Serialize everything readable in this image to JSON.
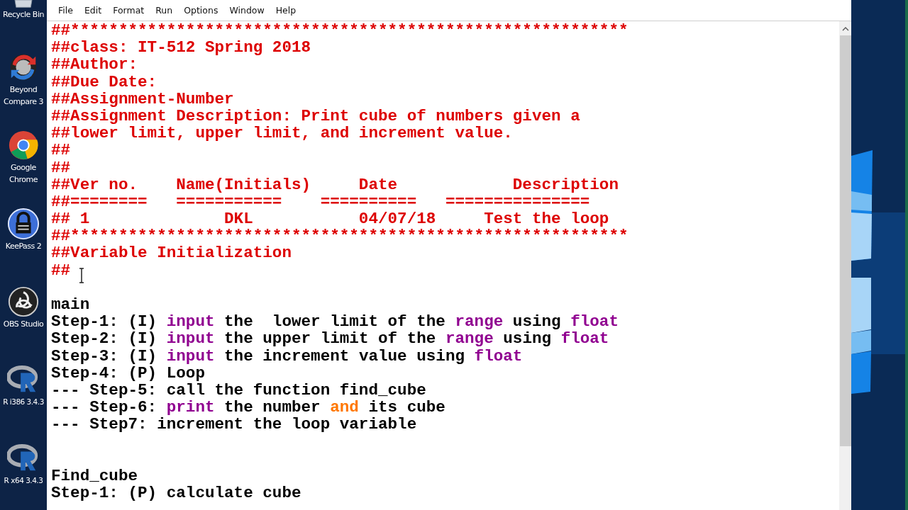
{
  "desktop_icons": [
    {
      "label": "Recycle Bin",
      "kind": "recycle"
    },
    {
      "label": "Beyond Compare 3",
      "kind": "compare"
    },
    {
      "label": "Google Chrome",
      "kind": "browser"
    },
    {
      "label": "KeePass 2",
      "kind": "lock"
    },
    {
      "label": "OBS Studio",
      "kind": "obs"
    },
    {
      "label": "R i386 3.4.3",
      "kind": "r"
    },
    {
      "label": "R x64 3.4.3",
      "kind": "r"
    }
  ],
  "menu": [
    "File",
    "Edit",
    "Format",
    "Run",
    "Options",
    "Window",
    "Help"
  ],
  "code_lines": [
    {
      "kind": "code",
      "segments": [
        {
          "text": "##**********************************************************",
          "kind": "comment"
        }
      ]
    },
    {
      "kind": "code",
      "segments": [
        {
          "text": "##class: IT-512 Spring 2018",
          "kind": "comment"
        }
      ]
    },
    {
      "kind": "code",
      "segments": [
        {
          "text": "##Author:",
          "kind": "comment"
        }
      ]
    },
    {
      "kind": "code",
      "segments": [
        {
          "text": "##Due Date:",
          "kind": "comment"
        }
      ]
    },
    {
      "kind": "code",
      "segments": [
        {
          "text": "##Assignment-Number",
          "kind": "comment"
        }
      ]
    },
    {
      "kind": "code",
      "segments": [
        {
          "text": "##Assignment Description: Print cube of numbers given a",
          "kind": "comment"
        }
      ]
    },
    {
      "kind": "code",
      "segments": [
        {
          "text": "##lower limit, upper limit, and increment value.",
          "kind": "comment"
        }
      ]
    },
    {
      "kind": "code",
      "segments": [
        {
          "text": "##",
          "kind": "comment"
        }
      ]
    },
    {
      "kind": "code",
      "segments": [
        {
          "text": "##",
          "kind": "comment"
        }
      ]
    },
    {
      "kind": "code",
      "segments": [
        {
          "text": "##Ver no.    Name(Initials)     Date            Description",
          "kind": "comment"
        }
      ]
    },
    {
      "kind": "code",
      "segments": [
        {
          "text": "##========   ===========    ==========   ===============",
          "kind": "comment"
        }
      ]
    },
    {
      "kind": "code",
      "segments": [
        {
          "text": "## 1              DKL           04/07/18     Test the loop",
          "kind": "comment"
        }
      ]
    },
    {
      "kind": "code",
      "segments": [
        {
          "text": "##**********************************************************",
          "kind": "comment"
        }
      ]
    },
    {
      "kind": "code",
      "segments": [
        {
          "text": "##Variable Initialization",
          "kind": "comment"
        }
      ]
    },
    {
      "kind": "code",
      "segments": [
        {
          "text": "##",
          "kind": "comment"
        }
      ]
    },
    {
      "kind": "blank"
    },
    {
      "kind": "code",
      "segments": [
        {
          "text": "main",
          "kind": "plain"
        }
      ]
    },
    {
      "kind": "code",
      "segments": [
        {
          "text": "Step-1: (I) ",
          "kind": "plain"
        },
        {
          "text": "input",
          "kind": "builtin"
        },
        {
          "text": " the  lower limit of the ",
          "kind": "plain"
        },
        {
          "text": "range",
          "kind": "builtin"
        },
        {
          "text": " using ",
          "kind": "plain"
        },
        {
          "text": "float",
          "kind": "builtin"
        }
      ]
    },
    {
      "kind": "code",
      "segments": [
        {
          "text": "Step-2: (I) ",
          "kind": "plain"
        },
        {
          "text": "input",
          "kind": "builtin"
        },
        {
          "text": " the upper limit of the ",
          "kind": "plain"
        },
        {
          "text": "range",
          "kind": "builtin"
        },
        {
          "text": " using ",
          "kind": "plain"
        },
        {
          "text": "float",
          "kind": "builtin"
        }
      ]
    },
    {
      "kind": "code",
      "segments": [
        {
          "text": "Step-3: (I) ",
          "kind": "plain"
        },
        {
          "text": "input",
          "kind": "builtin"
        },
        {
          "text": " the increment value using ",
          "kind": "plain"
        },
        {
          "text": "float",
          "kind": "builtin"
        }
      ]
    },
    {
      "kind": "code",
      "segments": [
        {
          "text": "Step-4: (P) Loop",
          "kind": "plain"
        }
      ]
    },
    {
      "kind": "code",
      "segments": [
        {
          "text": "--- Step-5: call the function find_cube",
          "kind": "plain"
        }
      ]
    },
    {
      "kind": "code",
      "segments": [
        {
          "text": "--- Step-6: ",
          "kind": "plain"
        },
        {
          "text": "print",
          "kind": "builtin"
        },
        {
          "text": " the number ",
          "kind": "plain"
        },
        {
          "text": "and",
          "kind": "keyword"
        },
        {
          "text": " its cube",
          "kind": "plain"
        }
      ]
    },
    {
      "kind": "code",
      "segments": [
        {
          "text": "--- Step7: increment the loop variable",
          "kind": "plain"
        }
      ]
    },
    {
      "kind": "blank"
    },
    {
      "kind": "blank"
    },
    {
      "kind": "code",
      "segments": [
        {
          "text": "Find_cube",
          "kind": "plain"
        }
      ]
    },
    {
      "kind": "code",
      "segments": [
        {
          "text": "Step-1: (P) calculate cube",
          "kind": "plain"
        }
      ]
    }
  ]
}
